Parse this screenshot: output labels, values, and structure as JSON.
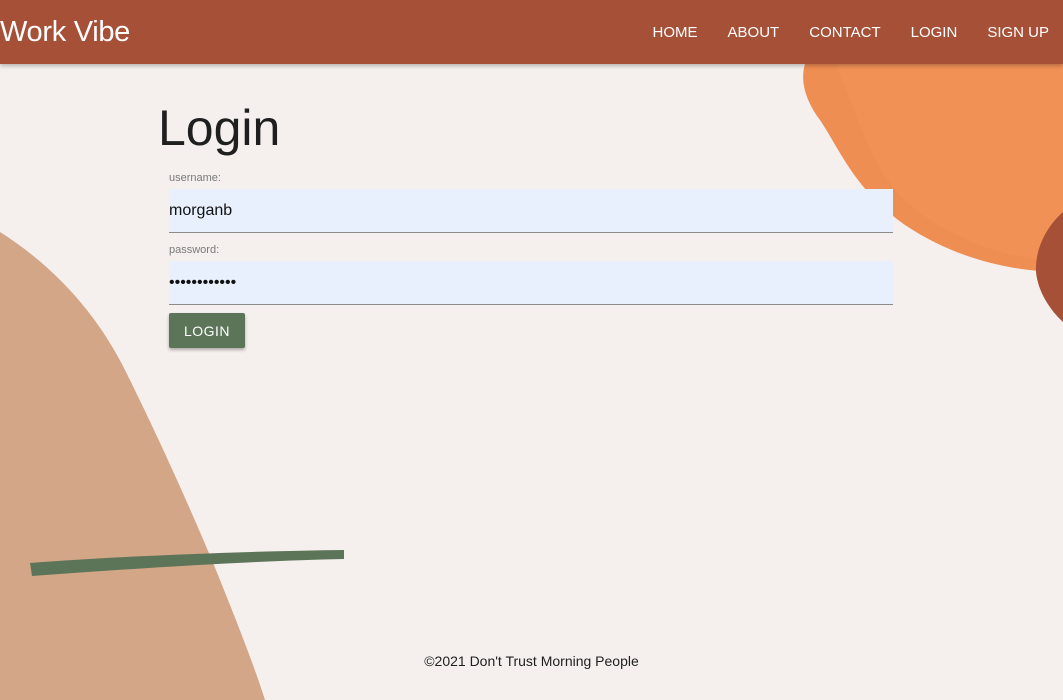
{
  "nav": {
    "brand": "Work Vibe",
    "links": [
      {
        "label": "HOME"
      },
      {
        "label": "ABOUT"
      },
      {
        "label": "CONTACT"
      },
      {
        "label": "LOGIN"
      },
      {
        "label": "SIGN UP"
      }
    ]
  },
  "main": {
    "title": "Login",
    "username": {
      "label": "username:",
      "value": "morganb"
    },
    "password": {
      "label": "password:",
      "value": "••••••••••••"
    },
    "submit_label": "LOGIN"
  },
  "footer": {
    "text": "©2021 Don't Trust Morning People"
  },
  "colors": {
    "navbar": "#a65038",
    "background": "#f5f0ee",
    "button": "#5c7559",
    "input_fill": "#e8f0fe",
    "shape_tan": "#d4a688",
    "shape_orange": "#ef8e53",
    "shape_rust": "#a65038",
    "brush_green": "#5c7559"
  }
}
